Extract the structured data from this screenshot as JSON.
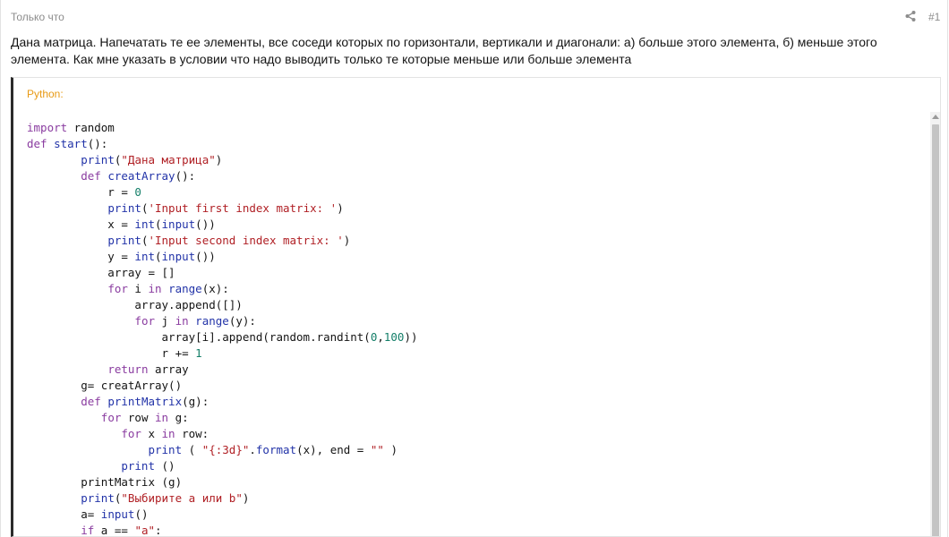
{
  "post": {
    "time": "Только что",
    "number": "#1",
    "message": "Дана матрица. Напечатать те ее элементы, все соседи которых по горизонтали, вертикали и диагонали: а) больше этого элемента, б) меньше этого элемента. Как мне указать в условии что надо выводить только те которые меньше или больше элемента"
  },
  "code": {
    "language_label": "Python:",
    "lines": [
      [
        [
          "kw",
          "import"
        ],
        [
          "p",
          " random"
        ]
      ],
      [
        [
          "kw",
          "def"
        ],
        [
          "p",
          " "
        ],
        [
          "bi",
          "start"
        ],
        [
          "p",
          "():"
        ]
      ],
      [
        [
          "p",
          "        "
        ],
        [
          "bi",
          "print"
        ],
        [
          "p",
          "("
        ],
        [
          "str",
          "\"Дана матрица\""
        ],
        [
          "p",
          ")"
        ]
      ],
      [
        [
          "p",
          "        "
        ],
        [
          "kw",
          "def"
        ],
        [
          "p",
          " "
        ],
        [
          "bi",
          "creatArray"
        ],
        [
          "p",
          "():"
        ]
      ],
      [
        [
          "p",
          "            r = "
        ],
        [
          "num",
          "0"
        ]
      ],
      [
        [
          "p",
          "            "
        ],
        [
          "bi",
          "print"
        ],
        [
          "p",
          "("
        ],
        [
          "str",
          "'Input first index matrix: '"
        ],
        [
          "p",
          ")"
        ]
      ],
      [
        [
          "p",
          "            x = "
        ],
        [
          "bi",
          "int"
        ],
        [
          "p",
          "("
        ],
        [
          "bi",
          "input"
        ],
        [
          "p",
          "())"
        ]
      ],
      [
        [
          "p",
          "            "
        ],
        [
          "bi",
          "print"
        ],
        [
          "p",
          "("
        ],
        [
          "str",
          "'Input second index matrix: '"
        ],
        [
          "p",
          ")"
        ]
      ],
      [
        [
          "p",
          "            y = "
        ],
        [
          "bi",
          "int"
        ],
        [
          "p",
          "("
        ],
        [
          "bi",
          "input"
        ],
        [
          "p",
          "())"
        ]
      ],
      [
        [
          "p",
          "            array = []"
        ]
      ],
      [
        [
          "p",
          "            "
        ],
        [
          "kw",
          "for"
        ],
        [
          "p",
          " i "
        ],
        [
          "kw",
          "in"
        ],
        [
          "p",
          " "
        ],
        [
          "bi",
          "range"
        ],
        [
          "p",
          "(x):"
        ]
      ],
      [
        [
          "p",
          "                array.append([])"
        ]
      ],
      [
        [
          "p",
          "                "
        ],
        [
          "kw",
          "for"
        ],
        [
          "p",
          " j "
        ],
        [
          "kw",
          "in"
        ],
        [
          "p",
          " "
        ],
        [
          "bi",
          "range"
        ],
        [
          "p",
          "(y):"
        ]
      ],
      [
        [
          "p",
          "                    array[i].append(random.randint("
        ],
        [
          "num",
          "0"
        ],
        [
          "p",
          ","
        ],
        [
          "num",
          "100"
        ],
        [
          "p",
          "))"
        ]
      ],
      [
        [
          "p",
          "                    r += "
        ],
        [
          "num",
          "1"
        ]
      ],
      [
        [
          "p",
          "            "
        ],
        [
          "kw",
          "return"
        ],
        [
          "p",
          " array"
        ]
      ],
      [
        [
          "p",
          "        g= creatArray()"
        ]
      ],
      [
        [
          "p",
          "        "
        ],
        [
          "kw",
          "def"
        ],
        [
          "p",
          " "
        ],
        [
          "bi",
          "printMatrix"
        ],
        [
          "p",
          "(g):"
        ]
      ],
      [
        [
          "p",
          "           "
        ],
        [
          "kw",
          "for"
        ],
        [
          "p",
          " row "
        ],
        [
          "kw",
          "in"
        ],
        [
          "p",
          " g:"
        ]
      ],
      [
        [
          "p",
          "              "
        ],
        [
          "kw",
          "for"
        ],
        [
          "p",
          " x "
        ],
        [
          "kw",
          "in"
        ],
        [
          "p",
          " row:"
        ]
      ],
      [
        [
          "p",
          "                  "
        ],
        [
          "bi",
          "print"
        ],
        [
          "p",
          " ( "
        ],
        [
          "str",
          "\"{:3d}\""
        ],
        [
          "p",
          "."
        ],
        [
          "bi",
          "format"
        ],
        [
          "p",
          "(x), end = "
        ],
        [
          "str",
          "\"\""
        ],
        [
          "p",
          " )"
        ]
      ],
      [
        [
          "p",
          "              "
        ],
        [
          "bi",
          "print"
        ],
        [
          "p",
          " ()"
        ]
      ],
      [
        [
          "p",
          "        printMatrix (g)"
        ]
      ],
      [
        [
          "p",
          "        "
        ],
        [
          "bi",
          "print"
        ],
        [
          "p",
          "("
        ],
        [
          "str",
          "\"Выбирите а или b\""
        ],
        [
          "p",
          ")"
        ]
      ],
      [
        [
          "p",
          "        a= "
        ],
        [
          "bi",
          "input"
        ],
        [
          "p",
          "()"
        ]
      ],
      [
        [
          "p",
          "        "
        ],
        [
          "kw",
          "if"
        ],
        [
          "p",
          " a == "
        ],
        [
          "str",
          "\"a\""
        ],
        [
          "p",
          ":"
        ]
      ]
    ]
  },
  "colors": {
    "keyword": "#8a3ca0",
    "builtin": "#2233a8",
    "string": "#b01f24",
    "number": "#137e68",
    "language_label": "#e89a15"
  },
  "icons": {
    "share": "share-icon"
  }
}
